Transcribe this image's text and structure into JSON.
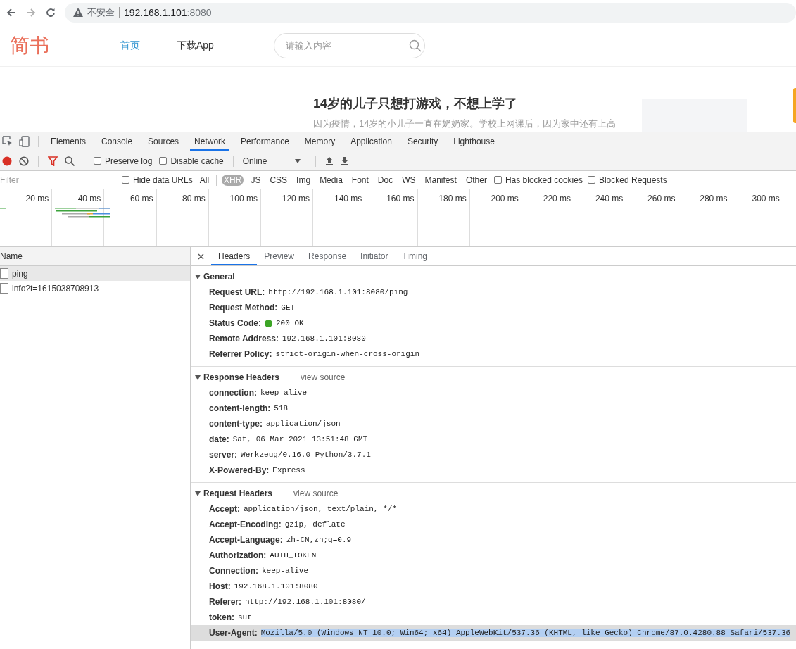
{
  "browser": {
    "security_label": "不安全",
    "url_host": "192.168.1.101",
    "url_port": ":8080"
  },
  "site": {
    "logo": "简书",
    "nav": [
      {
        "label": "首页",
        "selected": true
      },
      {
        "label": "下载App",
        "selected": false
      }
    ],
    "search": {
      "placeholder": "请输入内容"
    },
    "article": {
      "title": "14岁的儿子只想打游戏，不想上学了",
      "excerpt": "因为疫情，14岁的小儿子一直在奶奶家。学校上网课后，因为家中还有上高"
    }
  },
  "devtools": {
    "tabs": [
      {
        "label": "Elements",
        "selected": false
      },
      {
        "label": "Console",
        "selected": false
      },
      {
        "label": "Sources",
        "selected": false
      },
      {
        "label": "Network",
        "selected": true
      },
      {
        "label": "Performance",
        "selected": false
      },
      {
        "label": "Memory",
        "selected": false
      },
      {
        "label": "Application",
        "selected": false
      },
      {
        "label": "Security",
        "selected": false
      },
      {
        "label": "Lighthouse",
        "selected": false
      }
    ],
    "recording": true,
    "toolbar_options": [
      {
        "label": "Preserve log",
        "checked": false
      },
      {
        "label": "Disable cache",
        "checked": false
      }
    ],
    "throttling": "Online",
    "filter": {
      "placeholder": "Filter",
      "hide_data_urls": {
        "label": "Hide data URLs",
        "checked": false
      },
      "types": [
        {
          "label": "All",
          "selected": false
        },
        {
          "label": "XHR",
          "selected": true
        },
        {
          "label": "JS",
          "selected": false
        },
        {
          "label": "CSS",
          "selected": false
        },
        {
          "label": "Img",
          "selected": false
        },
        {
          "label": "Media",
          "selected": false
        },
        {
          "label": "Font",
          "selected": false
        },
        {
          "label": "Doc",
          "selected": false
        },
        {
          "label": "WS",
          "selected": false
        },
        {
          "label": "Manifest",
          "selected": false
        },
        {
          "label": "Other",
          "selected": false
        }
      ],
      "extra": [
        {
          "label": "Has blocked cookies",
          "checked": false
        },
        {
          "label": "Blocked Requests",
          "checked": false
        }
      ]
    },
    "timeline_ticks": [
      "20 ms",
      "40 ms",
      "60 ms",
      "80 ms",
      "100 ms",
      "120 ms",
      "140 ms",
      "160 ms",
      "180 ms",
      "200 ms",
      "220 ms",
      "240 ms",
      "260 ms",
      "280 ms",
      "300 ms"
    ],
    "requests": {
      "column": "Name",
      "rows": [
        {
          "name": "ping",
          "selected": true
        },
        {
          "name": "info?t=1615038708913",
          "selected": false
        }
      ]
    },
    "detail_tabs": [
      {
        "label": "Headers",
        "selected": true
      },
      {
        "label": "Preview",
        "selected": false
      },
      {
        "label": "Response",
        "selected": false
      },
      {
        "label": "Initiator",
        "selected": false
      },
      {
        "label": "Timing",
        "selected": false
      }
    ],
    "sections": [
      {
        "title": "General",
        "expanded": true,
        "rows": [
          {
            "name": "Request URL:",
            "value": "http://192.168.1.101:8080/ping",
            "kind": "text",
            "selected": false
          },
          {
            "name": "Request Method:",
            "value": "GET",
            "kind": "text",
            "selected": false
          },
          {
            "name": "Status Code:",
            "value": "200 OK",
            "kind": "status",
            "selected": false
          },
          {
            "name": "Remote Address:",
            "value": "192.168.1.101:8080",
            "kind": "text",
            "selected": false
          },
          {
            "name": "Referrer Policy:",
            "value": "strict-origin-when-cross-origin",
            "kind": "text",
            "selected": false
          }
        ]
      },
      {
        "title": "Response Headers",
        "link": "view source",
        "expanded": true,
        "rows": [
          {
            "name": "connection:",
            "value": "keep-alive",
            "kind": "text",
            "selected": false
          },
          {
            "name": "content-length:",
            "value": "518",
            "kind": "text",
            "selected": false
          },
          {
            "name": "content-type:",
            "value": "application/json",
            "kind": "text",
            "selected": false
          },
          {
            "name": "date:",
            "value": "Sat, 06 Mar 2021 13:51:48 GMT",
            "kind": "text",
            "selected": false
          },
          {
            "name": "server:",
            "value": "Werkzeug/0.16.0 Python/3.7.1",
            "kind": "text",
            "selected": false
          },
          {
            "name": "X-Powered-By:",
            "value": "Express",
            "kind": "text",
            "selected": false
          }
        ]
      },
      {
        "title": "Request Headers",
        "link": "view source",
        "expanded": true,
        "rows": [
          {
            "name": "Accept:",
            "value": "application/json, text/plain, */*",
            "kind": "text",
            "selected": false
          },
          {
            "name": "Accept-Encoding:",
            "value": "gzip, deflate",
            "kind": "text",
            "selected": false
          },
          {
            "name": "Accept-Language:",
            "value": "zh-CN,zh;q=0.9",
            "kind": "text",
            "selected": false
          },
          {
            "name": "Authorization:",
            "value": "AUTH_TOKEN",
            "kind": "text",
            "selected": false
          },
          {
            "name": "Connection:",
            "value": "keep-alive",
            "kind": "text",
            "selected": false
          },
          {
            "name": "Host:",
            "value": "192.168.1.101:8080",
            "kind": "text",
            "selected": false
          },
          {
            "name": "Referer:",
            "value": "http://192.168.1.101:8080/",
            "kind": "text",
            "selected": false
          },
          {
            "name": "token:",
            "value": "sut",
            "kind": "text",
            "selected": false
          },
          {
            "name": "User-Agent:",
            "value": "Mozilla/5.0 (Windows NT 10.0; Win64; x64) AppleWebKit/537.36 (KHTML, like Gecko) Chrome/87.0.4280.88 Safari/537.36",
            "kind": "text",
            "selected": true
          }
        ]
      }
    ]
  }
}
